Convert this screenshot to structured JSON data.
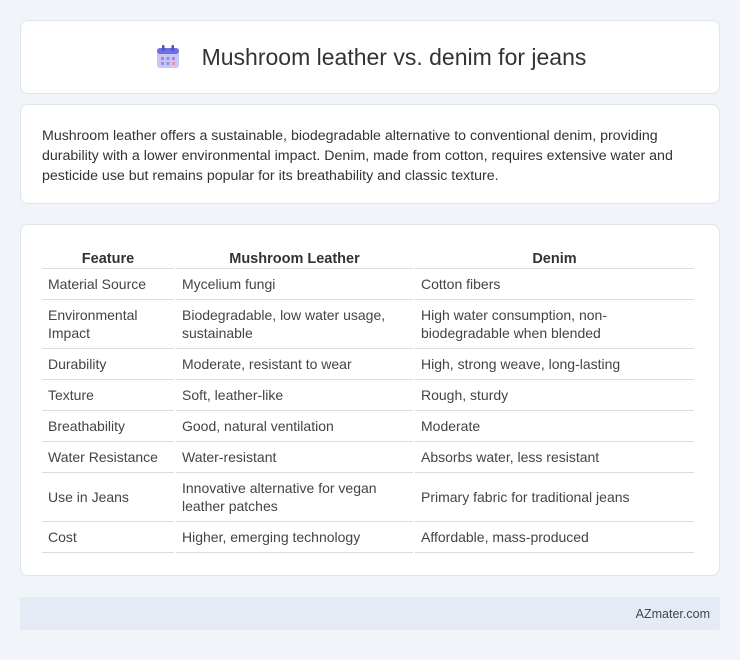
{
  "header": {
    "title": "Mushroom leather vs. denim for jeans",
    "icon": "calendar-icon"
  },
  "intro": {
    "text": "Mushroom leather offers a sustainable, biodegradable alternative to conventional denim, providing durability with a lower environmental impact. Denim, made from cotton, requires extensive water and pesticide use but remains popular for its breathability and classic texture."
  },
  "table": {
    "headers": [
      "Feature",
      "Mushroom Leather",
      "Denim"
    ],
    "rows": [
      [
        "Material Source",
        "Mycelium fungi",
        "Cotton fibers"
      ],
      [
        "Environmental Impact",
        "Biodegradable, low water usage, sustainable",
        "High water consumption, non-biodegradable when blended"
      ],
      [
        "Durability",
        "Moderate, resistant to wear",
        "High, strong weave, long-lasting"
      ],
      [
        "Texture",
        "Soft, leather-like",
        "Rough, sturdy"
      ],
      [
        "Breathability",
        "Good, natural ventilation",
        "Moderate"
      ],
      [
        "Water Resistance",
        "Water-resistant",
        "Absorbs water, less resistant"
      ],
      [
        "Use in Jeans",
        "Innovative alternative for vegan leather patches",
        "Primary fabric for traditional jeans"
      ],
      [
        "Cost",
        "Higher, emerging technology",
        "Affordable, mass-produced"
      ]
    ]
  },
  "footer": {
    "text": "AZmater.com"
  }
}
